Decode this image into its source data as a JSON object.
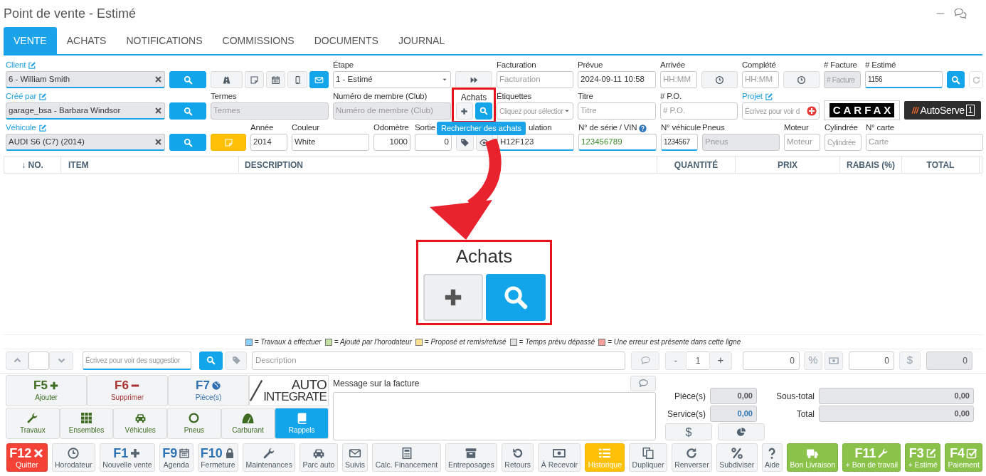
{
  "window": {
    "title": "Point de vente - Estimé"
  },
  "tabs": [
    {
      "label": "VENTE",
      "selected": true
    },
    {
      "label": "ACHATS",
      "selected": false
    },
    {
      "label": "NOTIFICATIONS",
      "selected": false
    },
    {
      "label": "COMMISSIONS",
      "selected": false
    },
    {
      "label": "DOCUMENTS",
      "selected": false
    },
    {
      "label": "JOURNAL",
      "selected": false
    }
  ],
  "form_rows": [
    [
      {
        "kind": "field",
        "label": "Client",
        "link": true,
        "value": "6 - William Smith",
        "clearable": true,
        "disabled": true,
        "highlighted": true
      },
      {
        "kind": "button"
      },
      {
        "kind": "button_group",
        "buttons": [
          {
            "selected": false
          },
          {
            "selected": false
          },
          {
            "selected": false
          },
          {
            "selected": false
          },
          {
            "selected": true
          }
        ]
      },
      {
        "kind": "select",
        "label": "Étape",
        "value": "1 - Estimé"
      },
      {
        "kind": "button"
      },
      {
        "kind": "field",
        "label": "Facturation",
        "placeholder": "Facturation"
      },
      {
        "kind": "field",
        "label": "Prévue",
        "value": "2024-09-11 10:58"
      },
      {
        "kind": "field",
        "label": "Arrivée",
        "placeholder": "HH:MM"
      },
      {
        "kind": "button"
      },
      {
        "kind": "field",
        "label": "Complété",
        "placeholder": "HH:MM"
      },
      {
        "kind": "button"
      },
      {
        "kind": "field",
        "label": "# Facture",
        "placeholder": "# Facture",
        "disabled": true
      },
      {
        "kind": "field",
        "label": "# Estimé",
        "value": "1156",
        "highlighted": true
      },
      {
        "kind": "button"
      },
      {
        "kind": "button"
      }
    ],
    [
      {
        "kind": "field",
        "label": "Créé par",
        "link": true,
        "value": "garage_bsa - Barbara Windsor",
        "clearable": true,
        "disabled": true,
        "highlighted": true
      },
      {
        "kind": "button"
      },
      {
        "kind": "field",
        "label": "Termes",
        "placeholder": "Termes",
        "disabled": true
      },
      {
        "kind": "field",
        "label": "Numéro de membre (Club)",
        "placeholder": "Numéro de membre (Club)",
        "disabled": true
      },
      {
        "kind": "achats",
        "label": "Achats",
        "highlighted": true
      },
      {
        "kind": "select",
        "label": "Étiquettes",
        "placeholder": "Cliquez pour sélectior"
      },
      {
        "kind": "field",
        "label": "Titre",
        "placeholder": "Titre"
      },
      {
        "kind": "field",
        "label": "# P.O.",
        "placeholder": "# P.O."
      },
      {
        "kind": "field",
        "label": "Projet",
        "link": true,
        "placeholder": "Écrivez pour voir d"
      },
      {
        "kind": "logo_boxed",
        "text": "CARFAX"
      },
      {
        "kind": "logo_dark",
        "text": "AutoServe",
        "badge": "1"
      }
    ],
    [
      {
        "kind": "field",
        "label": "Véhicule",
        "link": true,
        "value": "AUDI S6 (C7) (2014)",
        "clearable": true,
        "disabled": true,
        "highlighted": true
      },
      {
        "kind": "button"
      },
      {
        "kind": "button"
      },
      {
        "kind": "field",
        "label": "Année",
        "value": "2014"
      },
      {
        "kind": "field",
        "label": "Couleur",
        "value": "White"
      },
      {
        "kind": "field",
        "label": "Odomètre",
        "value": "1000",
        "numeric": true
      },
      {
        "kind": "field",
        "label": "Sortie",
        "value": "0",
        "numeric": true
      },
      {
        "kind": "button_group",
        "buttons": [
          {
            "selected": false
          },
          {
            "selected": false
          }
        ]
      },
      {
        "kind": "field",
        "label": "ulation",
        "value": "H12F123",
        "highlighted": true
      },
      {
        "kind": "field",
        "label": "N° de série / VIN",
        "value": "123456789",
        "valid": true,
        "highlighted": true
      },
      {
        "kind": "field",
        "label": "N° véhicule",
        "value": "1234567",
        "highlighted": true
      },
      {
        "kind": "field",
        "label": "Pneus",
        "placeholder": "Pneus",
        "disabled": true
      },
      {
        "kind": "field",
        "label": "Moteur",
        "placeholder": "Moteur"
      },
      {
        "kind": "field",
        "label": "Cylindrée",
        "placeholder": "Cylindrée"
      },
      {
        "kind": "field",
        "label": "N° carte",
        "placeholder": "Carte"
      }
    ]
  ],
  "tooltip": "Rechercher des achats",
  "table": {
    "columns": [
      "↓ NO.",
      "ITEM",
      "DESCRIPTION",
      "QUANTITÉ",
      "PRIX",
      "RABAIS (%)",
      "TOTAL"
    ]
  },
  "callout": {
    "title": "Achats"
  },
  "legend": [
    {
      "color": "#87cefa",
      "label": "= Travaux à effectuer"
    },
    {
      "color": "#c5e0a5",
      "label": "= Ajouté par l'horodateur"
    },
    {
      "color": "#fde08a",
      "label": "= Proposé et remis/refusé"
    },
    {
      "color": "#e0e0e0",
      "label": "= Temps prévu dépassé"
    },
    {
      "color": "#f4a09a",
      "label": "= Une erreur est présente dans cette ligne"
    }
  ],
  "entry": {
    "suggest_placeholder": "Écrivez pour voir des suggestior",
    "description_placeholder": "Description",
    "minus": "-",
    "quantity": "1",
    "plus": "+",
    "price": "0",
    "percent": "%",
    "discount": "0",
    "dollar": "$",
    "total": "0"
  },
  "actions": [
    {
      "key": "F5",
      "label": "Ajouter",
      "color": "#3d6b22"
    },
    {
      "key": "F6",
      "label": "Supprimer",
      "color": "#a83232"
    },
    {
      "key": "F7",
      "label": "Pièce(s)",
      "color": "#2f6fb0"
    }
  ],
  "partner_logo": {
    "line1": "AUTO",
    "line2": "INTEGRATE"
  },
  "categories": [
    {
      "label": "Travaux",
      "selected": false
    },
    {
      "label": "Ensembles",
      "selected": false
    },
    {
      "label": "Véhicules",
      "selected": false
    },
    {
      "label": "Pneus",
      "selected": false
    },
    {
      "label": "Carburant",
      "selected": false
    },
    {
      "label": "Rappels",
      "selected": true
    }
  ],
  "message": {
    "label": "Message sur la facture"
  },
  "totals": {
    "parts_label": "Pièce(s)",
    "parts": "0,00",
    "service_label": "Service(s)",
    "service": "0,00",
    "service_highlighted": true,
    "dollar": "$",
    "subtotal_label": "Sous-total",
    "subtotal": "0,00",
    "total_label": "Total",
    "total": "0,00"
  },
  "footer": [
    {
      "key": "F12",
      "label": "Quitter",
      "kind": "danger"
    },
    {
      "label": "Horodateur",
      "kind": "default"
    },
    {
      "key": "F1",
      "label": "Nouvelle vente",
      "kind": "default"
    },
    {
      "key": "F9",
      "label": "Agenda",
      "kind": "default"
    },
    {
      "key": "F10",
      "label": "Fermeture",
      "kind": "default"
    },
    {
      "label": "Maintenances",
      "kind": "default"
    },
    {
      "label": "Parc auto",
      "kind": "default"
    },
    {
      "label": "Suivis",
      "kind": "default"
    },
    {
      "label": "Calc. Financement",
      "kind": "default"
    },
    {
      "label": "Entreposages",
      "kind": "default"
    },
    {
      "label": "Retours",
      "kind": "default"
    },
    {
      "label": "À Recevoir",
      "kind": "default"
    },
    {
      "label": "Historique",
      "kind": "warning"
    },
    {
      "label": "Dupliquer",
      "kind": "default"
    },
    {
      "label": "Renverser",
      "kind": "default"
    },
    {
      "label": "Subdiviser",
      "kind": "default"
    },
    {
      "label": "Aide",
      "kind": "default"
    },
    {
      "label": "Bon Livraison",
      "kind": "success"
    },
    {
      "key": "F11",
      "label": "+ Bon de travail",
      "kind": "success"
    },
    {
      "key": "F3",
      "label": "+ Estimé",
      "kind": "success"
    },
    {
      "key": "F4",
      "label": "Paiement",
      "kind": "success"
    }
  ]
}
